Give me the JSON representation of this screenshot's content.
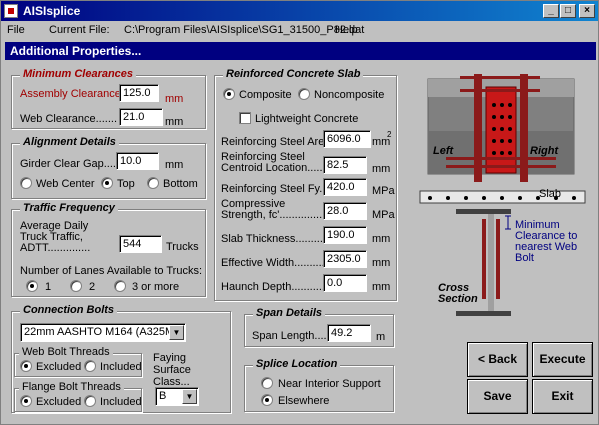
{
  "window": {
    "title": "AISIsplice"
  },
  "menu": {
    "file": "File",
    "current_file_label": "Current File:",
    "current_file_path": "C:\\Program Files\\AISIsplice\\SG1_31500_P82.dat",
    "help": "Help"
  },
  "strip_title": "Additional Properties...",
  "min_clearances": {
    "title": "Minimum Clearances",
    "assembly_label": "Assembly Clearance...",
    "assembly_value": "125.0",
    "web_label": "Web Clearance.......",
    "web_value": "21.0",
    "unit": "mm"
  },
  "alignment": {
    "title": "Alignment Details",
    "gap_label": "Girder Clear Gap........",
    "gap_value": "10.0",
    "unit": "mm",
    "options": [
      "Web Center",
      "Top",
      "Bottom"
    ],
    "selected": "Top"
  },
  "traffic": {
    "title": "Traffic Frequency",
    "adtt_line1": "Average Daily",
    "adtt_line2": "Truck Traffic,",
    "adtt_line3": "ADTT..............",
    "adtt_value": "544",
    "adtt_unit": "Trucks",
    "lanes_label": "Number of Lanes Available to Trucks:",
    "lane_options": [
      "1",
      "2",
      "3 or more"
    ],
    "lane_selected": "1"
  },
  "slab": {
    "title": "Reinforced Concrete Slab",
    "composite": "Composite",
    "noncomposite": "Noncomposite",
    "lightweight": "Lightweight Concrete",
    "reinf_area_label": "Reinforcing Steel Area..",
    "reinf_area_value": "6096.0",
    "reinf_area_unit": "mm",
    "reinf_area_sup": "2",
    "centroid_l1": "Reinforcing Steel",
    "centroid_l2": "Centroid Location..........",
    "centroid_value": "82.5",
    "centroid_unit": "mm",
    "fy_label": "Reinforcing Steel Fy.....",
    "fy_value": "420.0",
    "fy_unit": "MPa",
    "fc_l1": "Compressive",
    "fc_l2": "Strength, fc'...................",
    "fc_value": "28.0",
    "fc_unit": "MPa",
    "thickness_label": "Slab Thickness.............",
    "thickness_value": "190.0",
    "thickness_unit": "mm",
    "width_label": "Effective Width..............",
    "width_value": "2305.0",
    "width_unit": "mm",
    "haunch_label": "Haunch Depth...............",
    "haunch_value": "0.0",
    "haunch_unit": "mm"
  },
  "bolts": {
    "title": "Connection Bolts",
    "bolt_type": "22mm AASHTO M164 (A325M)",
    "web_threads_title": "Web Bolt Threads",
    "flange_threads_title": "Flange Bolt Threads",
    "excluded": "Excluded",
    "included": "Included",
    "faying_l1": "Faying",
    "faying_l2": "Surface",
    "faying_l3": "Class...",
    "faying_value": "B"
  },
  "span": {
    "title": "Span Details",
    "length_label": "Span Length.....",
    "length_value": "49.2",
    "unit": "m"
  },
  "splice": {
    "title": "Splice Location",
    "options": [
      "Near Interior Support",
      "Elsewhere"
    ],
    "selected": "Elsewhere"
  },
  "diagram": {
    "left": "Left",
    "right": "Right",
    "slab": "Slab",
    "min_clearance_l1": "Minimum",
    "min_clearance_l2": "Clearance to",
    "min_clearance_l3": "nearest Web",
    "min_clearance_l4": "Bolt",
    "cross_l1": "Cross",
    "cross_l2": "Section"
  },
  "buttons": {
    "back": "< Back",
    "execute": "Execute",
    "save": "Save",
    "exit": "Exit"
  }
}
